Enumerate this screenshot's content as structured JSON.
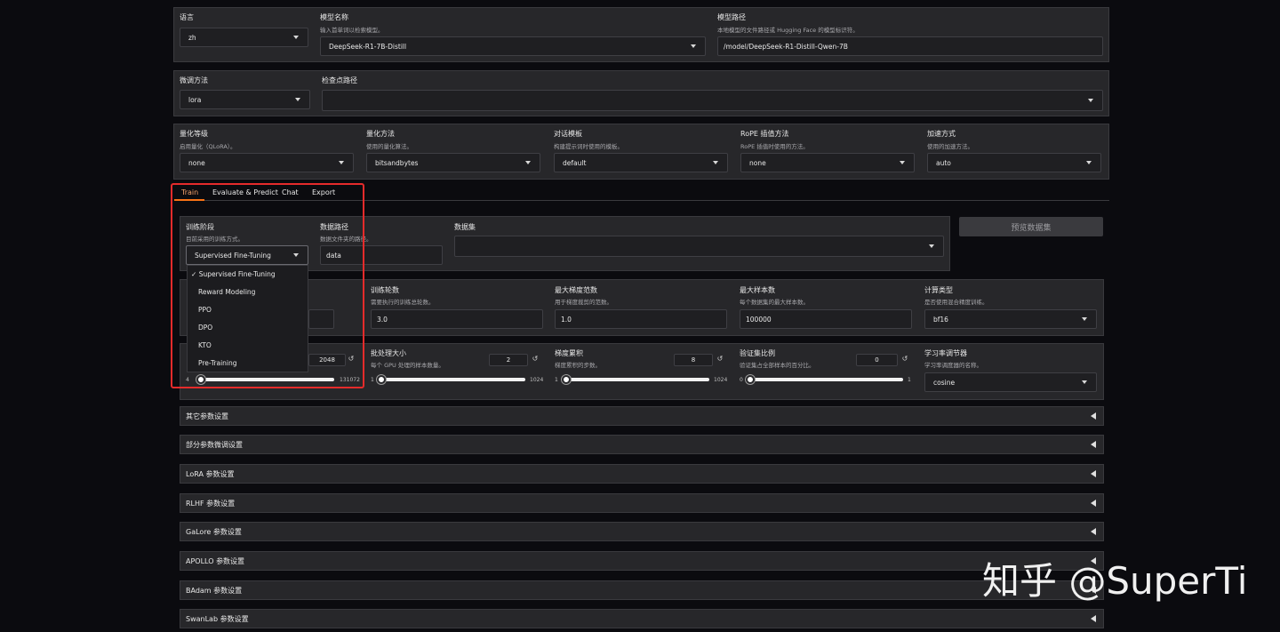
{
  "top": {
    "lang": {
      "label": "语言",
      "value": "zh"
    },
    "model_name": {
      "label": "模型名称",
      "info": "输入首单词以检索模型。",
      "value": "DeepSeek-R1-7B-Distill"
    },
    "model_path": {
      "label": "模型路径",
      "info": "本地模型的文件路径或 Hugging Face 的模型标识符。",
      "value": "/model/DeepSeek-R1-Distill-Qwen-7B"
    }
  },
  "row2": {
    "finetune": {
      "label": "微调方法",
      "value": "lora"
    },
    "checkpoint": {
      "label": "检查点路径",
      "value": ""
    }
  },
  "row3": {
    "quant_bit": {
      "label": "量化等级",
      "info": "启用量化（QLoRA）。",
      "value": "none"
    },
    "quant_method": {
      "label": "量化方法",
      "info": "使用的量化算法。",
      "value": "bitsandbytes"
    },
    "template": {
      "label": "对话模板",
      "info": "构建提示词时使用的模板。",
      "value": "default"
    },
    "rope": {
      "label": "RoPE 插值方法",
      "info": "RoPE 插值时使用的方法。",
      "value": "none"
    },
    "booster": {
      "label": "加速方式",
      "info": "使用的加速方法。",
      "value": "auto"
    }
  },
  "tabs": [
    "Train",
    "Evaluate & Predict",
    "Chat",
    "Export"
  ],
  "train": {
    "stage": {
      "label": "训练阶段",
      "info": "目前采用的训练方式。",
      "value": "Supervised Fine-Tuning"
    },
    "dataset_dir": {
      "label": "数据路径",
      "info": "数据文件夹的路径。",
      "value": "data"
    },
    "dataset": {
      "label": "数据集",
      "value": ""
    },
    "preview_button": "预览数据集",
    "stage_options": [
      "Supervised Fine-Tuning",
      "Reward Modeling",
      "PPO",
      "DPO",
      "KTO",
      "Pre-Training"
    ],
    "selected_mark": "✓",
    "epochs": {
      "label": "训练轮数",
      "info": "需要执行的训练总轮数。",
      "value": "3.0"
    },
    "max_grad_norm": {
      "label": "最大梯度范数",
      "info": "用于梯度裁剪的范数。",
      "value": "1.0"
    },
    "max_samples": {
      "label": "最大样本数",
      "info": "每个数据集的最大样本数。",
      "value": "100000"
    },
    "compute_type": {
      "label": "计算类型",
      "info": "是否使用混合精度训练。",
      "value": "bf16"
    },
    "cutoff_len": {
      "value": "2048",
      "min": "4",
      "max": "131072",
      "level": 0.016
    },
    "batch_size": {
      "label": "批处理大小",
      "info": "每个 GPU 处理的样本数量。",
      "value": "2",
      "min": "1",
      "max": "1024",
      "level": 0.001
    },
    "grad_accum": {
      "label": "梯度累积",
      "info": "梯度累积的步数。",
      "value": "8",
      "min": "1",
      "max": "1024",
      "level": 0.007
    },
    "val_size": {
      "label": "验证集比例",
      "info": "验证集占全部样本的百分比。",
      "value": "0",
      "min": "0",
      "max": "1",
      "level": 0
    },
    "lr_scheduler": {
      "label": "学习率调节器",
      "info": "学习率调度器的名称。",
      "value": "cosine"
    },
    "reset_glyph": "↺"
  },
  "accordions": [
    "其它参数设置",
    "部分参数微调设置",
    "LoRA 参数设置",
    "RLHF 参数设置",
    "GaLore 参数设置",
    "APOLLO 参数设置",
    "BAdam 参数设置",
    "SwanLab 参数设置"
  ],
  "watermark": "知乎 @SuperTi",
  "colors": {
    "highlight": "#e52b2b",
    "tab_active": "#f97316"
  }
}
